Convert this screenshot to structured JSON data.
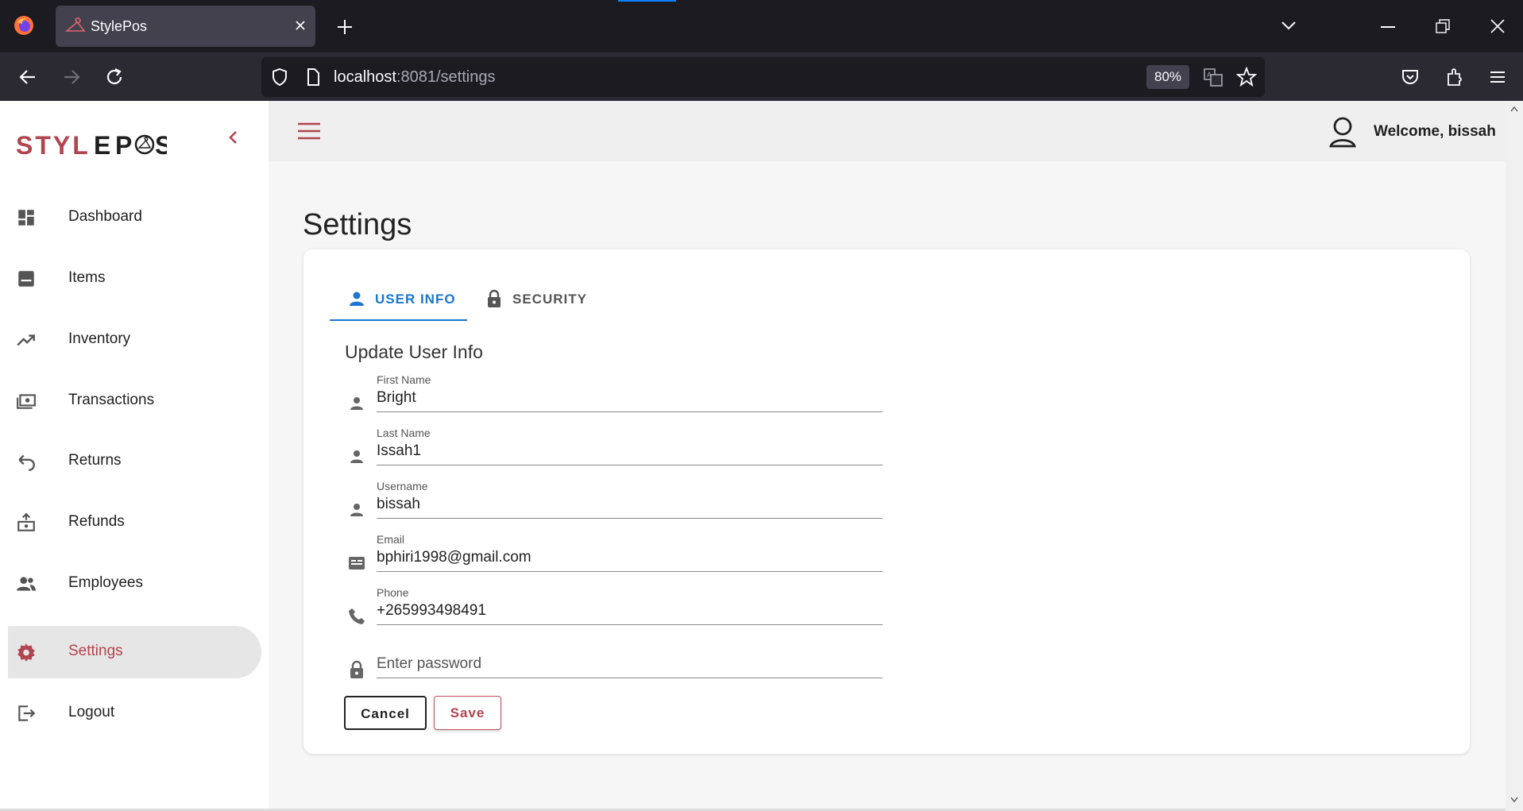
{
  "browser": {
    "tab_title": "StylePos",
    "url_host": "localhost",
    "url_path": ":8081/settings",
    "zoom": "80%"
  },
  "app": {
    "logo_text": "STYLEPOS",
    "welcome": "Welcome, bissah",
    "accent_color": "#b2444f",
    "primary_color": "#1976d2"
  },
  "sidebar": {
    "items": [
      {
        "label": "Dashboard",
        "icon": "dashboard-icon"
      },
      {
        "label": "Items",
        "icon": "items-icon"
      },
      {
        "label": "Inventory",
        "icon": "trending-up-icon"
      },
      {
        "label": "Transactions",
        "icon": "money-icon"
      },
      {
        "label": "Returns",
        "icon": "undo-icon"
      },
      {
        "label": "Refunds",
        "icon": "refund-icon"
      },
      {
        "label": "Employees",
        "icon": "people-icon"
      },
      {
        "label": "Settings",
        "icon": "gear-icon",
        "active": true
      },
      {
        "label": "Logout",
        "icon": "logout-icon"
      }
    ]
  },
  "page": {
    "title": "Settings",
    "tabs": [
      {
        "label": "USER INFO",
        "icon": "person-icon",
        "active": true
      },
      {
        "label": "SECURITY",
        "icon": "lock-icon",
        "active": false
      }
    ],
    "form_title": "Update User Info",
    "fields": {
      "first_name": {
        "label": "First Name",
        "value": "Bright"
      },
      "last_name": {
        "label": "Last Name",
        "value": "Issah1"
      },
      "username": {
        "label": "Username",
        "value": "bissah"
      },
      "email": {
        "label": "Email",
        "value": "bphiri1998@gmail.com"
      },
      "phone": {
        "label": "Phone",
        "value": "+265993498491"
      },
      "password": {
        "placeholder": "Enter password"
      }
    },
    "buttons": {
      "cancel": "Cancel",
      "save": "Save"
    }
  }
}
